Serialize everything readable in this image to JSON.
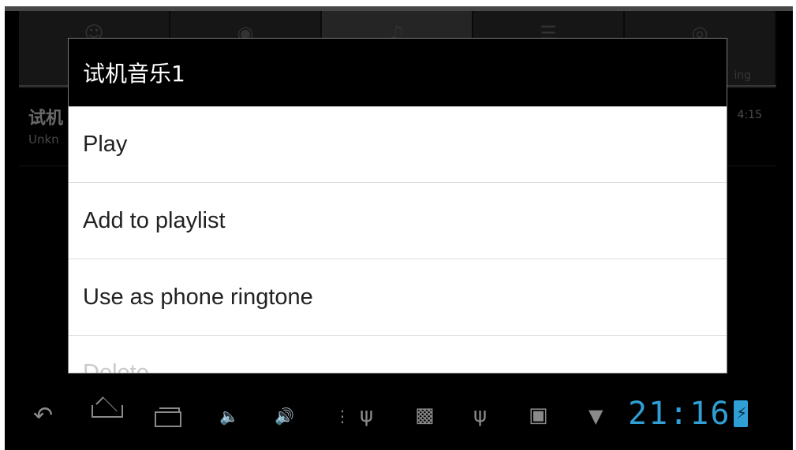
{
  "background": {
    "tabs": [
      {
        "label": "",
        "icon": "artists-icon"
      },
      {
        "label": "",
        "icon": "albums-icon"
      },
      {
        "label": "",
        "icon": "songs-icon"
      },
      {
        "label": "",
        "icon": "playlists-icon"
      },
      {
        "label": "ing",
        "icon": "now-playing-icon"
      }
    ],
    "track": {
      "title": "试机",
      "artist": "Unkn",
      "duration": "4:15"
    }
  },
  "dialog": {
    "title": "试机音乐1",
    "items": [
      {
        "label": "Play"
      },
      {
        "label": "Add to playlist"
      },
      {
        "label": "Use as phone ringtone"
      },
      {
        "label": "Delete"
      }
    ]
  },
  "system_bar": {
    "time": "21:16",
    "icons": [
      "back-icon",
      "home-icon",
      "recent-apps-icon",
      "volume-down-icon",
      "volume-up-icon",
      "menu-icon",
      "usb-icon",
      "usb-debugging-icon",
      "usb-icon",
      "sd-card-icon",
      "wifi-icon",
      "battery-charging-icon"
    ]
  },
  "colors": {
    "clock": "#2f9fd6",
    "battery": "#2f9fd6",
    "dialog_title_bg": "#000000"
  }
}
